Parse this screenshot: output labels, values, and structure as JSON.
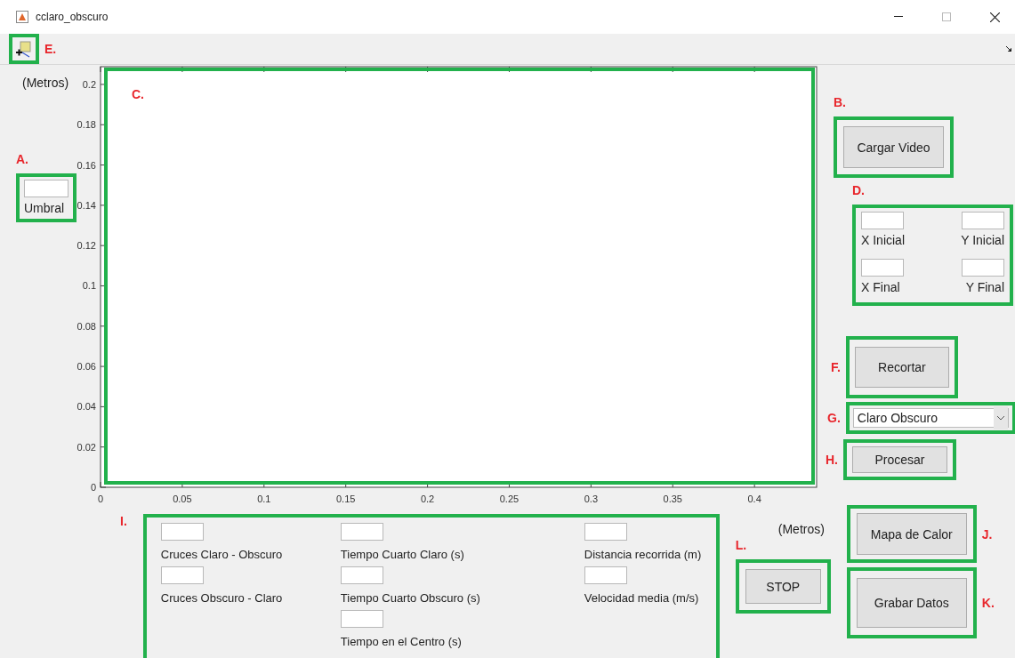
{
  "window": {
    "title": "cclaro_obscuro"
  },
  "toolbar": {
    "marker": "E."
  },
  "threshold": {
    "marker": "A.",
    "label": "Umbral"
  },
  "plot": {
    "marker": "C.",
    "chart_data": {
      "type": "line",
      "xlabel": "(Metros)",
      "ylabel": "(Metros)",
      "xlim": [
        0,
        0.438
      ],
      "ylim": [
        0,
        0.2088
      ],
      "xticks": [
        0,
        0.05,
        0.1,
        0.15,
        0.2,
        0.25,
        0.3,
        0.35,
        0.4
      ],
      "yticks": [
        0,
        0.02,
        0.04,
        0.06,
        0.08,
        0.1,
        0.12,
        0.14,
        0.16,
        0.18,
        0.2
      ]
    }
  },
  "load_button": {
    "marker": "B.",
    "label": "Cargar Video"
  },
  "crop_fields": {
    "marker": "D.",
    "fields": [
      {
        "label": "X Inicial"
      },
      {
        "label": "Y Inicial"
      },
      {
        "label": "X Final"
      },
      {
        "label": "Y Final"
      }
    ]
  },
  "crop_button": {
    "marker": "F.",
    "label": "Recortar"
  },
  "mode_select": {
    "marker": "G.",
    "value": "Claro Obscuro"
  },
  "process_button": {
    "marker": "H.",
    "label": "Procesar"
  },
  "results": {
    "marker": "I.",
    "columns": [
      [
        {
          "label": "Cruces Claro - Obscuro"
        },
        {
          "label": "Cruces Obscuro - Claro"
        }
      ],
      [
        {
          "label": "Tiempo Cuarto Claro (s)"
        },
        {
          "label": "Tiempo Cuarto Obscuro (s)"
        },
        {
          "label": "Tiempo en el Centro (s)"
        }
      ],
      [
        {
          "label": "Distancia recorrida (m)"
        },
        {
          "label": "Velocidad media (m/s)"
        }
      ]
    ]
  },
  "stop_button": {
    "marker": "L.",
    "label": "STOP"
  },
  "heatmap_button": {
    "marker": "J.",
    "label": "Mapa de Calor"
  },
  "save_button": {
    "marker": "K.",
    "label": "Grabar Datos"
  }
}
